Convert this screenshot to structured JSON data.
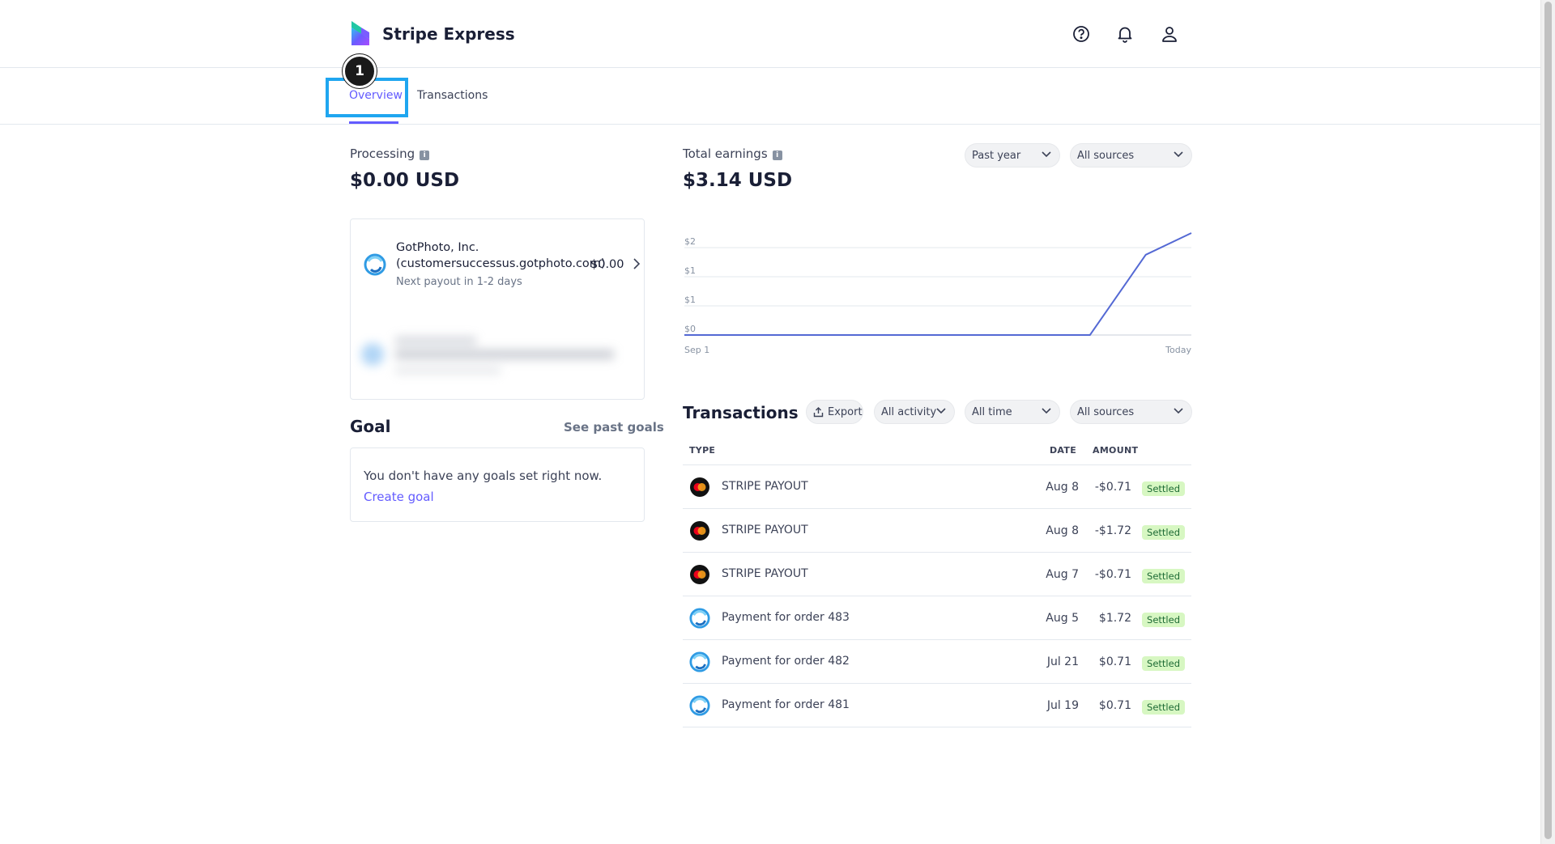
{
  "app": {
    "title": "Stripe Express"
  },
  "header_icons": [
    "help-icon",
    "bell-icon",
    "user-icon"
  ],
  "tabs": [
    {
      "label": "Overview",
      "active": true
    },
    {
      "label": "Transactions",
      "active": false
    }
  ],
  "annotation": {
    "step": "1"
  },
  "processing": {
    "label": "Processing",
    "amount": "$0.00 USD"
  },
  "payout_card": {
    "name": "GotPhoto, Inc. (customersuccessus.gotphoto.com)",
    "amount": "$0.00",
    "subtitle": "Next payout in 1-2 days"
  },
  "goal": {
    "title": "Goal",
    "see_past": "See past goals",
    "empty_text": "You don't have any goals set right now.",
    "create_link": "Create goal"
  },
  "earnings": {
    "label": "Total earnings",
    "amount": "$3.14 USD",
    "period_select": "Past year",
    "sources_select": "All sources"
  },
  "chart_data": {
    "type": "line",
    "x_labels": [
      "Sep 1",
      "Today"
    ],
    "y_tick_labels": [
      "$2",
      "$1",
      "$1",
      "$0"
    ],
    "series": [
      {
        "points": [
          [
            0,
            0
          ],
          [
            0.8,
            0
          ],
          [
            0.91,
            1.85
          ],
          [
            1.0,
            2.35
          ]
        ]
      }
    ],
    "ylim": [
      0,
      2.5
    ],
    "color": "#5469d4",
    "grid": true
  },
  "transactions": {
    "title": "Transactions",
    "export_label": "Export",
    "activity_select": "All activity",
    "time_select": "All time",
    "sources_select": "All sources",
    "columns": {
      "type": "TYPE",
      "date": "DATE",
      "amount": "AMOUNT"
    },
    "rows": [
      {
        "icon": "mastercard-icon",
        "type": "STRIPE PAYOUT",
        "date": "Aug 8",
        "amount": "-$0.71",
        "status": "Settled"
      },
      {
        "icon": "mastercard-icon",
        "type": "STRIPE PAYOUT",
        "date": "Aug 8",
        "amount": "-$1.72",
        "status": "Settled"
      },
      {
        "icon": "mastercard-icon",
        "type": "STRIPE PAYOUT",
        "date": "Aug 7",
        "amount": "-$0.71",
        "status": "Settled"
      },
      {
        "icon": "gotphoto-icon",
        "type": "Payment for order 483",
        "date": "Aug 5",
        "amount": "$1.72",
        "status": "Settled"
      },
      {
        "icon": "gotphoto-icon",
        "type": "Payment for order 482",
        "date": "Jul 21",
        "amount": "$0.71",
        "status": "Settled"
      },
      {
        "icon": "gotphoto-icon",
        "type": "Payment for order 481",
        "date": "Jul 19",
        "amount": "$0.71",
        "status": "Settled"
      }
    ]
  },
  "colors": {
    "accent": "#635bff",
    "highlight": "#1fa6f0",
    "settled_bg": "#d7f7c2",
    "settled_fg": "#1e6b35"
  }
}
